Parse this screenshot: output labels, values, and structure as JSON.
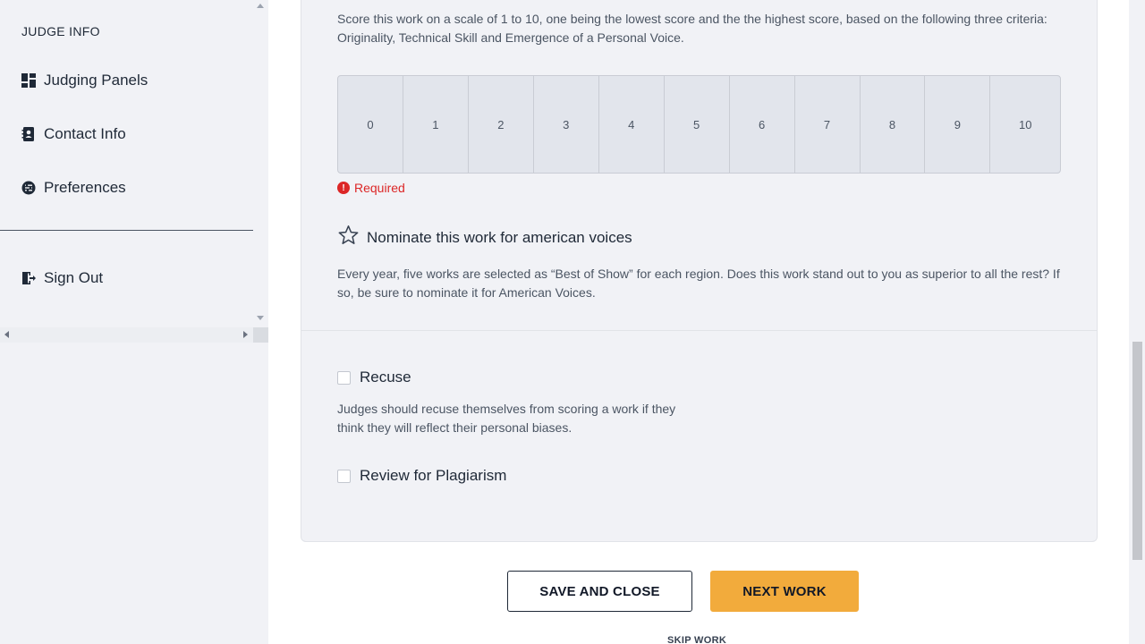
{
  "sidebar": {
    "header": "JUDGE INFO",
    "items": [
      {
        "label": "Judging Panels",
        "icon": "dashboard-icon"
      },
      {
        "label": "Contact Info",
        "icon": "contact-book-icon"
      },
      {
        "label": "Preferences",
        "icon": "settings-icon"
      }
    ],
    "sign_out": {
      "label": "Sign Out",
      "icon": "sign-out-icon"
    }
  },
  "main": {
    "intro": "Score this work on a scale of 1 to 10, one being the lowest score and the the highest score, based on the following three criteria: Originality, Technical Skill and Emergence of a Personal Voice.",
    "scale": [
      "0",
      "1",
      "2",
      "3",
      "4",
      "5",
      "6",
      "7",
      "8",
      "9",
      "10"
    ],
    "required_text": "Required",
    "nominate": {
      "label": "Nominate this work for american voices",
      "description": "Every year, five works are selected as “Best of Show” for each region. Does this work stand out to you as superior to all the rest? If so, be sure to nominate it for American Voices."
    },
    "recuse": {
      "label": "Recuse",
      "checked": false,
      "description": "Judges should recuse themselves from scoring a work if they think they will reflect their personal biases."
    },
    "plagiarism": {
      "label": "Review for Plagiarism",
      "checked": false
    },
    "buttons": {
      "save_close": "SAVE AND CLOSE",
      "next_work": "NEXT WORK",
      "skip_work": "SKIP WORK"
    }
  },
  "colors": {
    "accent": "#f2ab3c",
    "error": "#dc2626",
    "sidebar_bg": "#f1f2f6",
    "card_bg": "#f1f2f6"
  }
}
